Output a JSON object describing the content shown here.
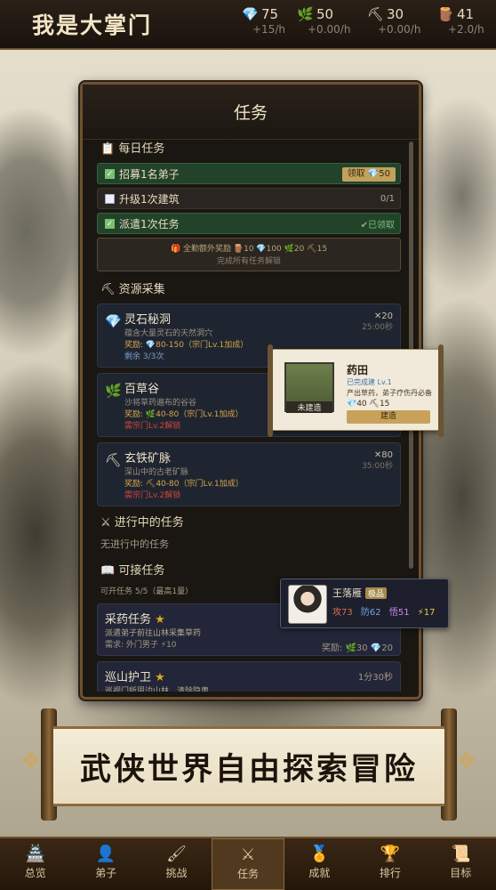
{
  "app": {
    "title": "我是大掌门"
  },
  "resources": [
    {
      "icon": "gem-icon",
      "glyph": "💎",
      "value": "75",
      "rate": "+15/h"
    },
    {
      "icon": "herb-icon",
      "glyph": "🌿",
      "value": "50",
      "rate": "+0.00/h"
    },
    {
      "icon": "pickaxe-icon",
      "glyph": "⛏",
      "value": "30",
      "rate": "+0.00/h"
    },
    {
      "icon": "wood-icon",
      "glyph": "🪵",
      "value": "41",
      "rate": "+2.0/h"
    }
  ],
  "panel": {
    "title": "任务"
  },
  "daily": {
    "heading": "每日任务",
    "tasks": [
      {
        "label": "招募1名弟子",
        "status": "done",
        "claim": "领取 💎50"
      },
      {
        "label": "升级1次建筑",
        "status": "todo",
        "progress": "0/1"
      },
      {
        "label": "派遣1次任务",
        "status": "done",
        "note": "✔已领取"
      }
    ],
    "bonus": {
      "title": "🎁 全勤额外奖励 🪵10 💎100 🌿20 ⛏15",
      "sub": "完成所有任务解锁"
    }
  },
  "gather": {
    "heading": "资源采集",
    "items": [
      {
        "name": "灵石秘洞",
        "glyph": "💎",
        "desc": "蕴含大量灵石的天然洞穴",
        "reward": "奖励: 💎80-150（宗门Lv.1加成）",
        "extra": "剩余 3/3次",
        "right": "✕20",
        "sub": "25:00秒"
      },
      {
        "name": "百草谷",
        "glyph": "🌿",
        "desc": "沙将草药遍布的谷谷",
        "reward": "奖励: 🌿40-80（宗门Lv.1加成）",
        "extra": "需宗门Lv.2解锁",
        "right": "",
        "sub": ""
      },
      {
        "name": "玄铁矿脉",
        "glyph": "⛏",
        "desc": "深山中的古老矿脉",
        "reward": "奖励: ⛏40-80（宗门Lv.1加成）",
        "extra": "需宗门Lv.2解锁",
        "right": "✕80",
        "sub": "35:00秒"
      }
    ]
  },
  "ongoing": {
    "heading": "进行中的任务",
    "empty": "无进行中的任务"
  },
  "available": {
    "heading": "可接任务",
    "count": "可开任务 5/5（最高1量）",
    "items": [
      {
        "name": "采药任务",
        "desc": "派遣弟子前往山林采集草药",
        "req": "需求: 外门男子 ⚡10",
        "right": "奖励: 🌿30 💎20"
      },
      {
        "name": "巡山护卫",
        "desc": "巡视门所周边山林，清除隐患",
        "req": "",
        "right": "1分30秒"
      }
    ]
  },
  "tooltip_building": {
    "name": "药田",
    "level": "已完成建 Lv.1",
    "desc": "产出草药，弟子疗伤丹必备",
    "cost": "💎40 ⛏15",
    "status": "未建造",
    "button": "建造"
  },
  "tooltip_disciple": {
    "name": "王落雁",
    "rank": "极品",
    "atk": "攻73",
    "def": "防62",
    "agi": "悟51",
    "energy": "⚡17"
  },
  "banner": {
    "slogan": "武侠世界自由探索冒险"
  },
  "nav": [
    {
      "icon": "home-icon",
      "glyph": "🏯",
      "label": "总览"
    },
    {
      "icon": "disciple-icon",
      "glyph": "👤",
      "label": "弟子"
    },
    {
      "icon": "brush-icon",
      "glyph": "🖌",
      "label": "挑战"
    },
    {
      "icon": "swords-icon",
      "glyph": "⚔",
      "label": "任务",
      "active": true
    },
    {
      "icon": "medal-icon",
      "glyph": "🏅",
      "label": "成就"
    },
    {
      "icon": "trophy-icon",
      "glyph": "🏆",
      "label": "排行"
    },
    {
      "icon": "scroll-icon",
      "glyph": "📜",
      "label": "目标"
    }
  ]
}
